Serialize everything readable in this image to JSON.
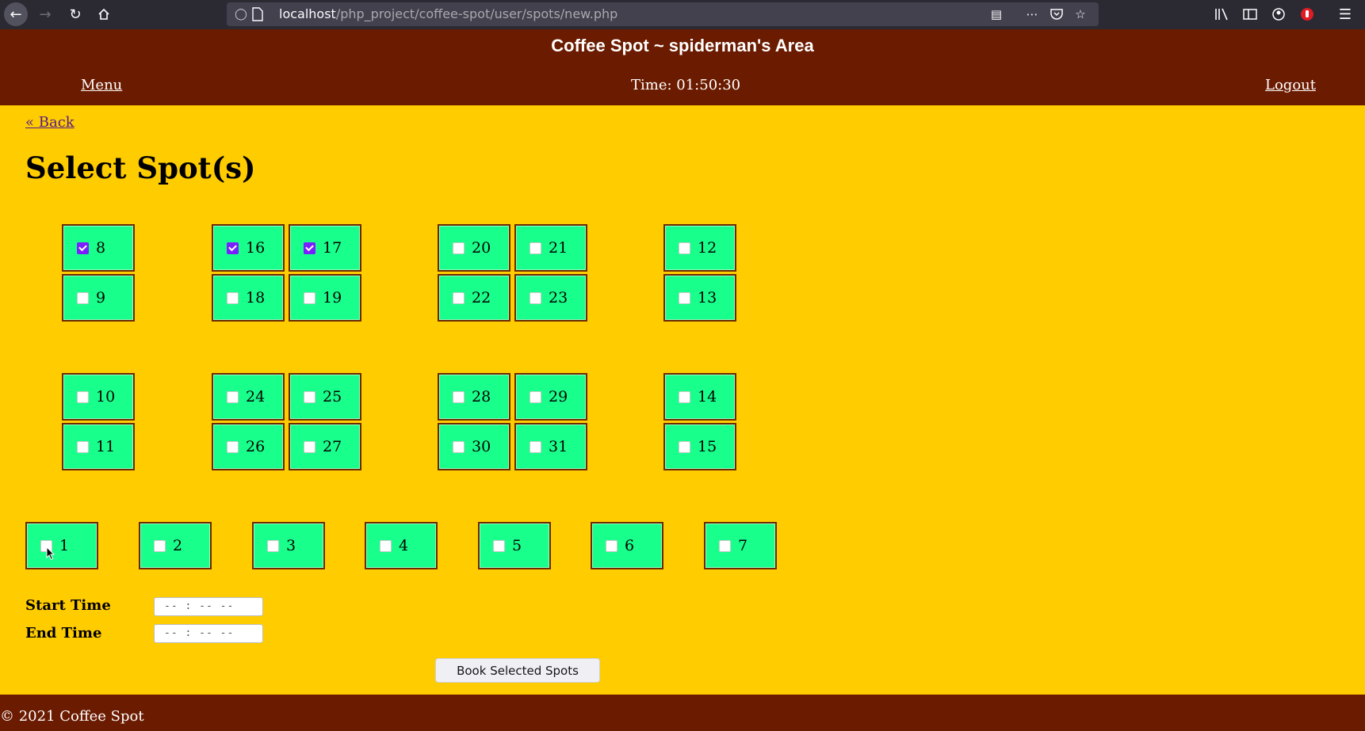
{
  "browser": {
    "url_host": "localhost",
    "url_path": "/php_project/coffee-spot/user/spots/new.php"
  },
  "header": {
    "title": "Coffee Spot ~ spiderman's Area",
    "menu_label": "Menu",
    "time_text": "Time: 01:50:30",
    "logout_label": "Logout"
  },
  "main": {
    "back_label": "« Back",
    "heading": "Select Spot(s)"
  },
  "spots": [
    {
      "number": "8",
      "checked": true
    },
    {
      "number": "9",
      "checked": false
    },
    {
      "number": "16",
      "checked": true
    },
    {
      "number": "17",
      "checked": true
    },
    {
      "number": "18",
      "checked": false
    },
    {
      "number": "19",
      "checked": false
    },
    {
      "number": "20",
      "checked": false
    },
    {
      "number": "21",
      "checked": false
    },
    {
      "number": "22",
      "checked": false
    },
    {
      "number": "23",
      "checked": false
    },
    {
      "number": "12",
      "checked": false
    },
    {
      "number": "13",
      "checked": false
    },
    {
      "number": "10",
      "checked": false
    },
    {
      "number": "11",
      "checked": false
    },
    {
      "number": "24",
      "checked": false
    },
    {
      "number": "25",
      "checked": false
    },
    {
      "number": "26",
      "checked": false
    },
    {
      "number": "27",
      "checked": false
    },
    {
      "number": "28",
      "checked": false
    },
    {
      "number": "29",
      "checked": false
    },
    {
      "number": "30",
      "checked": false
    },
    {
      "number": "31",
      "checked": false
    },
    {
      "number": "14",
      "checked": false
    },
    {
      "number": "15",
      "checked": false
    },
    {
      "number": "1",
      "checked": false
    },
    {
      "number": "2",
      "checked": false
    },
    {
      "number": "3",
      "checked": false
    },
    {
      "number": "4",
      "checked": false
    },
    {
      "number": "5",
      "checked": false
    },
    {
      "number": "6",
      "checked": false
    },
    {
      "number": "7",
      "checked": false
    }
  ],
  "form": {
    "start_label": "Start Time",
    "start_value": "-- : --   --",
    "end_label": "End Time",
    "end_value": "-- : --   --",
    "submit_label": "Book Selected Spots"
  },
  "footer": {
    "text": "© 2021 Coffee Spot"
  },
  "colors": {
    "page_bg": "#ffcc00",
    "header_bg": "#6b1b00",
    "spot_bg": "#19ff8c",
    "checkbox_checked": "#7a1fff"
  }
}
